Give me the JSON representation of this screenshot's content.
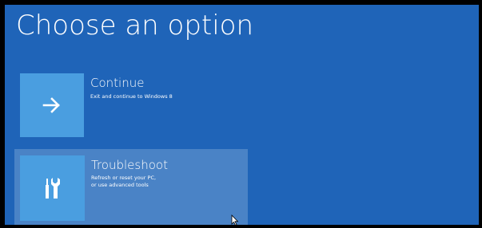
{
  "page": {
    "title": "Choose an option"
  },
  "options": [
    {
      "label": "Continue",
      "description": "Exit and continue to Windows 8",
      "icon": "arrow-right-icon"
    },
    {
      "label": "Troubleshoot",
      "description": "Refresh or reset your PC, or use advanced tools",
      "icon": "tools-icon"
    }
  ],
  "colors": {
    "background": "#1f64b8",
    "tile": "#4a9ee0",
    "selected_highlight": "#4a83c6",
    "text": "#ffffff"
  }
}
